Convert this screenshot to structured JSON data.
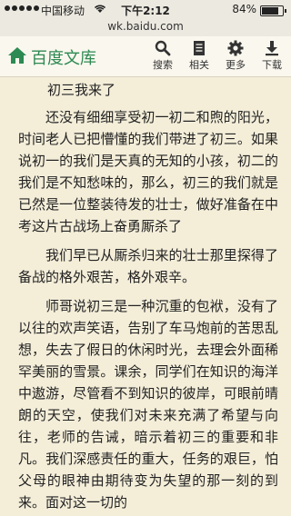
{
  "status": {
    "carrier": "中国移动",
    "time": "下午2:12",
    "battery": "84%",
    "battery_level": 0.84,
    "url": "wk.baidu.com"
  },
  "toolbar": {
    "brand": "百度文库",
    "search_label": "搜索",
    "related_label": "相关",
    "more_label": "更多",
    "download_label": "下载"
  },
  "colors": {
    "brand": "#2d8a52",
    "background": "#f4eed9"
  },
  "article": {
    "heading": "初三我来了",
    "paragraphs": [
      "还没有细细享受初一初二和煦的阳光，时间老人已把懵懂的我们带进了初三。如果说初一的我们是天真的无知的小孩，初二的我们是不知愁味的，那么，初三的我们就是已然是一位整装待发的壮士，做好准备在中考这片古战场上奋勇厮杀了",
      "我们早已从厮杀归来的壮士那里探得了备战的格外艰苦，格外艰辛。",
      "师哥说初三是一种沉重的包袱，没有了以往的欢声笑语，告别了车马炮前的苦思乱想，失去了假日的休闲时光，去理会外面稀罕美丽的雪景。课余，同学们在知识的海洋中遨游，尽管看不到知识的彼岸，可眼前晴朗的天空，使我们对未来充满了希望与向往，老师的告诫，暗示着初三的重要和非凡。我们深感责任的重大，任务的艰巨，怕父母的眼神由期待变为失望的那一刻的到来。面对这一切的"
    ]
  }
}
